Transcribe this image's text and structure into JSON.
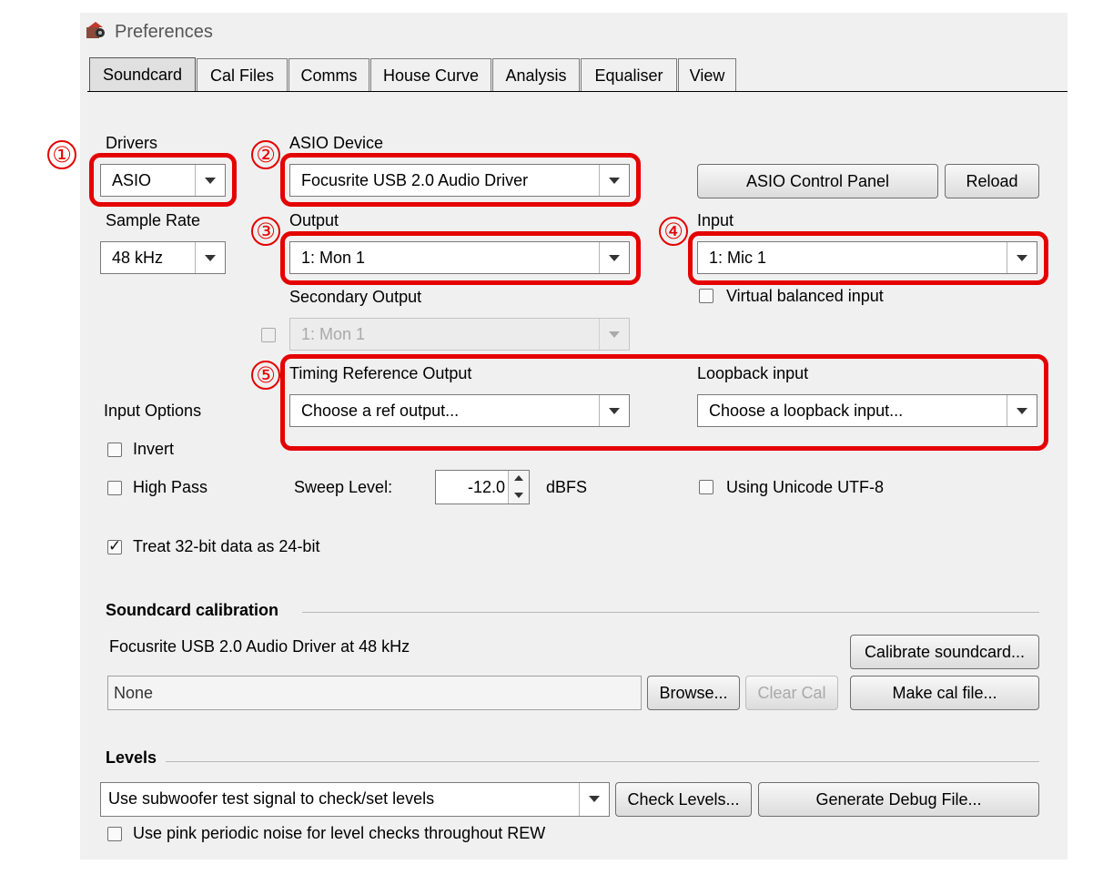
{
  "window": {
    "title": "Preferences"
  },
  "tabs": [
    "Soundcard",
    "Cal Files",
    "Comms",
    "House Curve",
    "Analysis",
    "Equaliser",
    "View"
  ],
  "active_tab": "Soundcard",
  "annotations": [
    "①",
    "②",
    "③",
    "④",
    "⑤"
  ],
  "accent_color": "#e50000",
  "drivers": {
    "label": "Drivers",
    "value": "ASIO"
  },
  "sample_rate": {
    "label": "Sample Rate",
    "value": "48 kHz"
  },
  "asio_device": {
    "label": "ASIO Device",
    "value": "Focusrite USB 2.0 Audio Driver"
  },
  "buttons": {
    "asio_control_panel": "ASIO Control Panel",
    "reload": "Reload",
    "calibrate": "Calibrate soundcard...",
    "browse": "Browse...",
    "clear_cal": "Clear Cal",
    "make_cal": "Make cal file...",
    "check_levels": "Check Levels...",
    "debug": "Generate Debug File..."
  },
  "output": {
    "label": "Output",
    "value": "1: Mon 1"
  },
  "input": {
    "label": "Input",
    "value": "1: Mic 1"
  },
  "virtual_balanced": {
    "label": "Virtual balanced input",
    "checked": false
  },
  "secondary_output": {
    "label": "Secondary Output",
    "value": "1: Mon 1",
    "enabled": false
  },
  "timing_ref": {
    "label": "Timing Reference Output",
    "value": "Choose a ref output..."
  },
  "loopback": {
    "label": "Loopback input",
    "value": "Choose a loopback input..."
  },
  "input_options": {
    "label": "Input Options",
    "invert": "Invert",
    "high_pass": "High Pass",
    "treat_32bit": "Treat 32-bit data as 24-bit"
  },
  "sweep_level": {
    "label": "Sweep Level:",
    "value": "-12.0",
    "unit": "dBFS"
  },
  "unicode": {
    "label": "Using Unicode UTF-8",
    "checked": false
  },
  "calibration": {
    "title": "Soundcard calibration",
    "device_text": "Focusrite USB 2.0 Audio Driver at 48 kHz",
    "file_value": "None"
  },
  "levels": {
    "title": "Levels",
    "mode_value": "Use subwoofer test signal to check/set levels",
    "pink_noise": "Use pink periodic noise for level checks throughout REW"
  }
}
